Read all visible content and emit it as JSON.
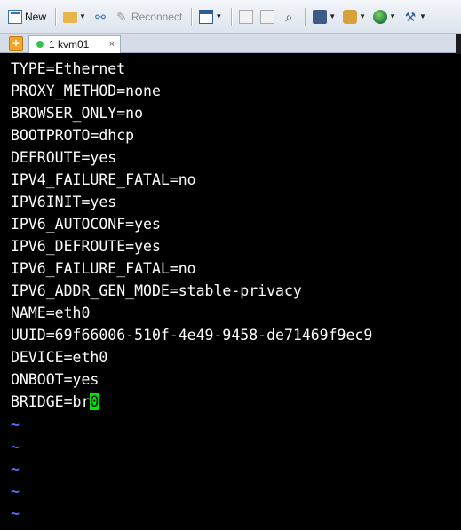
{
  "toolbar": {
    "new_label": "New",
    "reconnect_label": "Reconnect",
    "icons": [
      "new-session-icon",
      "open-folder-icon",
      "link-icon",
      "reconnect-icon",
      "window-icon",
      "copy-icon",
      "paste-icon",
      "find-icon",
      "print-icon",
      "keys-icon",
      "globe-icon",
      "tools-icon"
    ]
  },
  "tabs": [
    {
      "label": "1 kvm01",
      "status_color": "#34c24a",
      "close": "×"
    }
  ],
  "terminal": {
    "lines": [
      "TYPE=Ethernet",
      "PROXY_METHOD=none",
      "BROWSER_ONLY=no",
      "BOOTPROTO=dhcp",
      "DEFROUTE=yes",
      "IPV4_FAILURE_FATAL=no",
      "IPV6INIT=yes",
      "IPV6_AUTOCONF=yes",
      "IPV6_DEFROUTE=yes",
      "IPV6_FAILURE_FATAL=no",
      "IPV6_ADDR_GEN_MODE=stable-privacy",
      "NAME=eth0",
      "UUID=69f66006-510f-4e49-9458-de71469f9ec9",
      "DEVICE=eth0",
      "ONBOOT=yes"
    ],
    "last_line_prefix": "BRIDGE=br",
    "cursor_char": "0",
    "tilde": "~",
    "cursor_color": "#00e600",
    "tilde_color": "#5b6cff"
  }
}
